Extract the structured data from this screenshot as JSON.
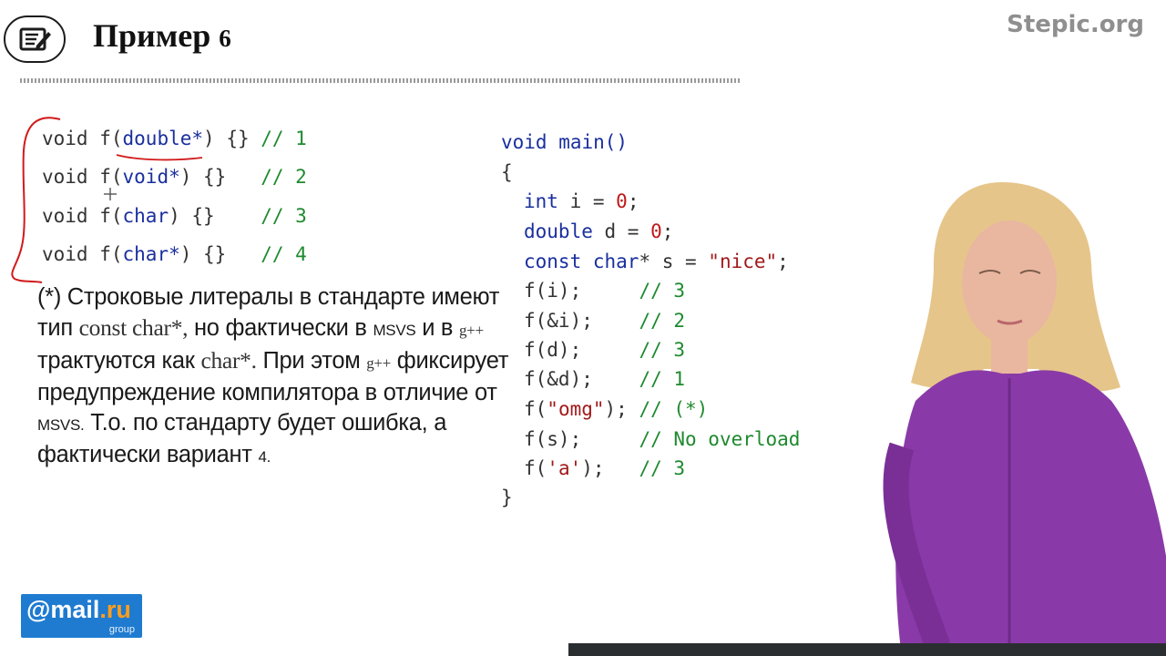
{
  "header": {
    "title": "Пример",
    "title_number": "6",
    "brand": "Stepic.org",
    "icon": "notepad-pen-icon"
  },
  "left_code": [
    {
      "pre": "void f(",
      "type": "double*",
      "post": ") {} ",
      "comment": "// 1"
    },
    {
      "pre": "void f(",
      "type": "void*",
      "post": ") {}   ",
      "comment": "// 2"
    },
    {
      "pre": "void f(",
      "type": "char",
      "post": ") {}    ",
      "comment": "// 3"
    },
    {
      "pre": "void f(",
      "type": "char*",
      "post": ") {}   ",
      "comment": "// 4"
    }
  ],
  "right_code": {
    "line1": "void main()",
    "open_brace": "{",
    "decl_int": {
      "type": "int",
      "rest": " i = ",
      "value": "0",
      "end": ";"
    },
    "decl_double": {
      "type": "double",
      "rest": " d = ",
      "value": "0",
      "end": ";"
    },
    "decl_const": {
      "type": "const char",
      "rest": "* s = ",
      "value": "\"nice\"",
      "end": ";"
    },
    "calls": [
      {
        "call": "f(i);     ",
        "comment": "// 3"
      },
      {
        "call": "f(&i);    ",
        "comment": "// 2"
      },
      {
        "call": "f(d);     ",
        "comment": "// 3"
      },
      {
        "call": "f(&d);    ",
        "comment": "// 1"
      },
      {
        "pre": "f(",
        "literal": "\"omg\"",
        "post": "); ",
        "comment": "// (*)"
      },
      {
        "call": "f(s);     ",
        "comment": "// No overload"
      },
      {
        "pre": "f(",
        "literal": "'a'",
        "post": ");   ",
        "comment": "// 3"
      }
    ],
    "close_brace": "}"
  },
  "note": {
    "star": "(*)",
    "t1": " Строковые литералы в стандарте имеют тип ",
    "code1": "const char*,",
    "t2": " но фактически в ",
    "msvs1": "MSVS",
    "t3": " и в ",
    "gpp1": "g++",
    "t4": " трактуются как ",
    "code2": "char*.",
    "t5": "  При этом ",
    "gpp2": "g++",
    "t6": " фиксирует предупреждение компилятора в отличие от ",
    "msvs2": "MSVS.",
    "t7": " Т.о. по стандарту будет ошибка, а фактически вариант ",
    "variant": "4."
  },
  "logo": {
    "at": "@",
    "mail": "mail",
    "dot": ".",
    "ru": "ru",
    "group": "group"
  },
  "colors": {
    "keyword": "#1a2f9e",
    "comment": "#1e8a2e",
    "number": "#c01818",
    "string": "#a11a1a",
    "annotation_red": "#d11a1a",
    "logo_blue": "#1e7bd0",
    "brand_gray": "#8f8f8f"
  }
}
